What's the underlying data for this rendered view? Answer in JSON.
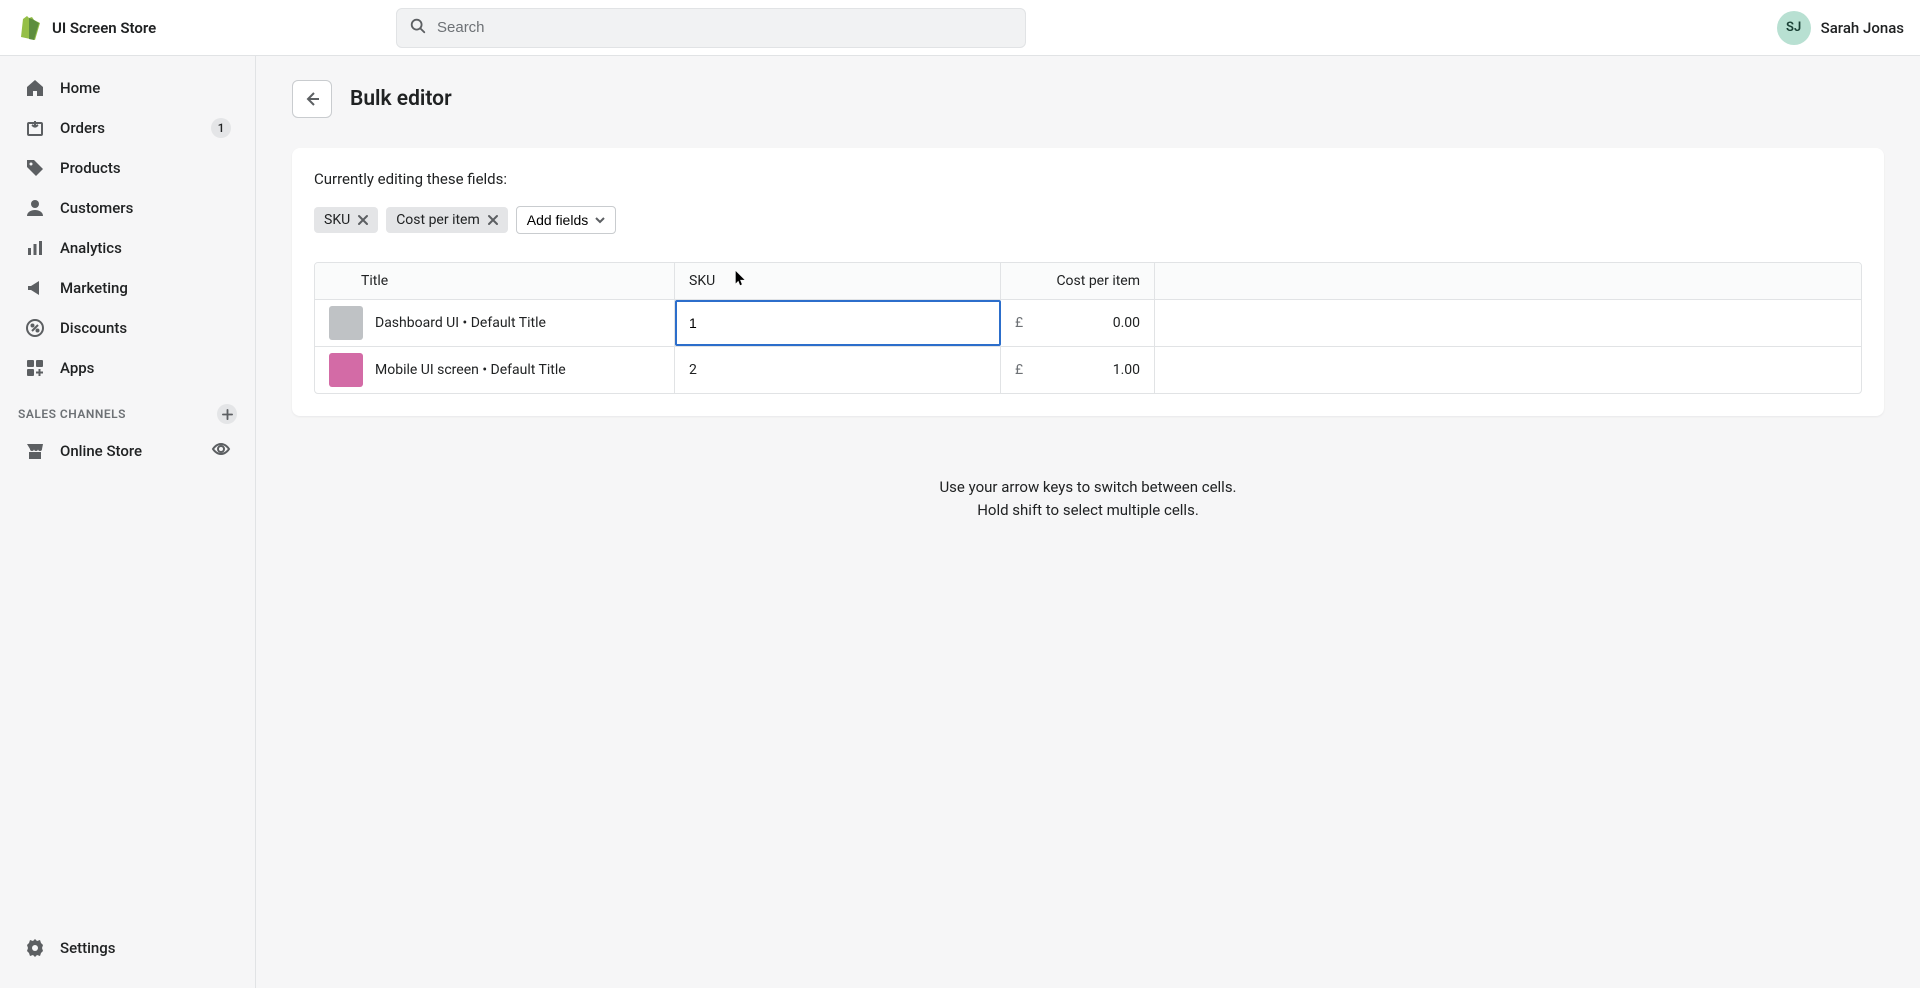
{
  "topbar": {
    "store_name": "UI Screen Store",
    "search_placeholder": "Search",
    "user_initials": "SJ",
    "user_name": "Sarah Jonas"
  },
  "sidebar": {
    "items": [
      {
        "label": "Home"
      },
      {
        "label": "Orders",
        "badge": "1"
      },
      {
        "label": "Products"
      },
      {
        "label": "Customers"
      },
      {
        "label": "Analytics"
      },
      {
        "label": "Marketing"
      },
      {
        "label": "Discounts"
      },
      {
        "label": "Apps"
      }
    ],
    "channels_header": "SALES CHANNELS",
    "channels": [
      {
        "label": "Online Store"
      }
    ],
    "settings": "Settings"
  },
  "page": {
    "title": "Bulk editor",
    "fields_label": "Currently editing these fields:",
    "chips": [
      {
        "label": "SKU"
      },
      {
        "label": "Cost per item"
      }
    ],
    "add_fields": "Add fields",
    "columns": {
      "title": "Title",
      "sku": "SKU",
      "cost": "Cost per item"
    },
    "currency": "£",
    "rows": [
      {
        "title": "Dashboard UI • Default Title",
        "sku": "1",
        "cost": "0.00",
        "active": true,
        "thumb_grey": true
      },
      {
        "title": "Mobile UI screen • Default Title",
        "sku": "2",
        "cost": "1.00",
        "active": false,
        "thumb_grey": false
      }
    ],
    "hint1": "Use your arrow keys to switch between cells.",
    "hint2": "Hold shift to select multiple cells."
  }
}
